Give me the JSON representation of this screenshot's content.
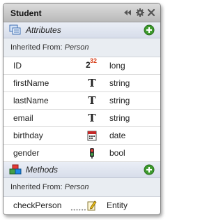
{
  "window": {
    "title": "Student"
  },
  "attributes": {
    "label": "Attributes",
    "inherited_prefix": "Inherited From:",
    "inherited_class": "Person",
    "rows": [
      {
        "name": "ID",
        "type": "long",
        "icon": "int64-icon"
      },
      {
        "name": "firstName",
        "type": "string",
        "icon": "text-icon"
      },
      {
        "name": "lastName",
        "type": "string",
        "icon": "text-icon"
      },
      {
        "name": "email",
        "type": "string",
        "icon": "text-icon"
      },
      {
        "name": "birthday",
        "type": "date",
        "icon": "calendar-icon"
      },
      {
        "name": "gender",
        "type": "bool",
        "icon": "traffic-light-icon"
      }
    ]
  },
  "methods": {
    "label": "Methods",
    "inherited_prefix": "Inherited From:",
    "inherited_class": "Person",
    "rows": [
      {
        "name": "checkPerson",
        "type": "Entity",
        "icon": "pencil-icon"
      }
    ]
  },
  "icons": {
    "id_superscript": "32",
    "id_base": "2",
    "text_glyph": "T"
  },
  "colors": {
    "accent_green": "#3c9a2c",
    "header_blue": "#d7ddea",
    "id_superscript_red": "#d9431e"
  }
}
